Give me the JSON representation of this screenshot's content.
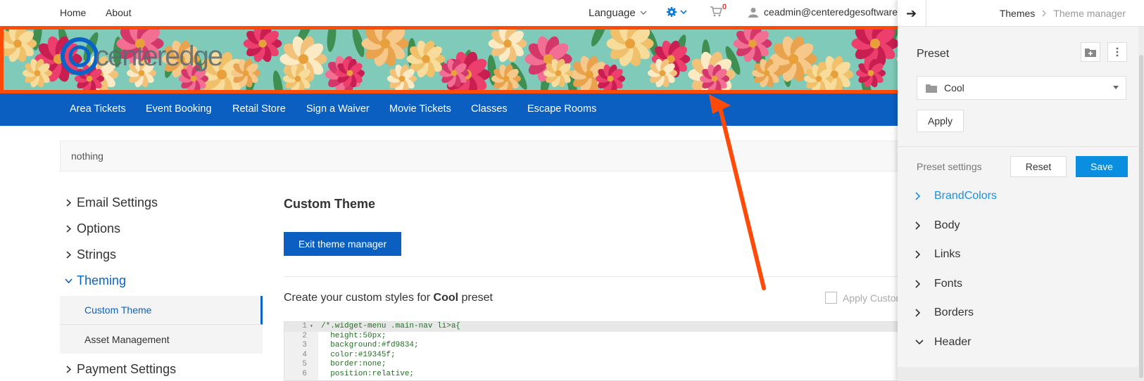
{
  "top_nav": {
    "home": "Home",
    "about": "About",
    "language": "Language",
    "cart_count": "0",
    "user_email": "ceadmin@centeredgesoftware"
  },
  "brand": {
    "logo_text": "centeredge"
  },
  "main_nav": [
    "Area Tickets",
    "Event Booking",
    "Retail Store",
    "Sign a Waiver",
    "Movie Tickets",
    "Classes",
    "Escape Rooms"
  ],
  "breadcrumb_box": {
    "text": "nothing"
  },
  "sidebar": {
    "items": [
      {
        "label": "Email Settings"
      },
      {
        "label": "Options"
      },
      {
        "label": "Strings"
      },
      {
        "label": "Theming"
      }
    ],
    "sub_items": [
      {
        "label": "Custom Theme"
      },
      {
        "label": "Asset Management"
      }
    ],
    "after": [
      {
        "label": "Payment Settings"
      }
    ]
  },
  "content": {
    "title": "Custom Theme",
    "exit_button": "Exit theme manager",
    "custom_styles_prefix": "Create your custom styles for ",
    "custom_styles_preset": "Cool",
    "custom_styles_suffix": " preset",
    "apply_custom": "Apply Custom"
  },
  "editor": {
    "lines": [
      {
        "n": "1",
        "code": "/*.widget-menu .main-nav li>a{"
      },
      {
        "n": "2",
        "code": "  height:50px;"
      },
      {
        "n": "3",
        "code": "  background:#fd9834;"
      },
      {
        "n": "4",
        "code": "  color:#19345f;"
      },
      {
        "n": "5",
        "code": "  border:none;"
      },
      {
        "n": "6",
        "code": "  position:relative;"
      }
    ]
  },
  "panel": {
    "breadcrumb": [
      "Themes",
      "Theme manager"
    ],
    "preset_label": "Preset",
    "preset_value": "Cool",
    "apply_button": "Apply",
    "settings_label": "Preset settings",
    "reset_button": "Reset",
    "save_button": "Save",
    "settings": [
      {
        "label": "BrandColors"
      },
      {
        "label": "Body"
      },
      {
        "label": "Links"
      },
      {
        "label": "Fonts"
      },
      {
        "label": "Borders"
      },
      {
        "label": "Header"
      }
    ]
  },
  "colors": {
    "nav_blue": "#0a5fc1",
    "accent_blue": "#1a8fe3",
    "banner_border": "#ff4a0a",
    "arrow": "#ff4a0a",
    "banner_bg": "#7fcab8"
  }
}
